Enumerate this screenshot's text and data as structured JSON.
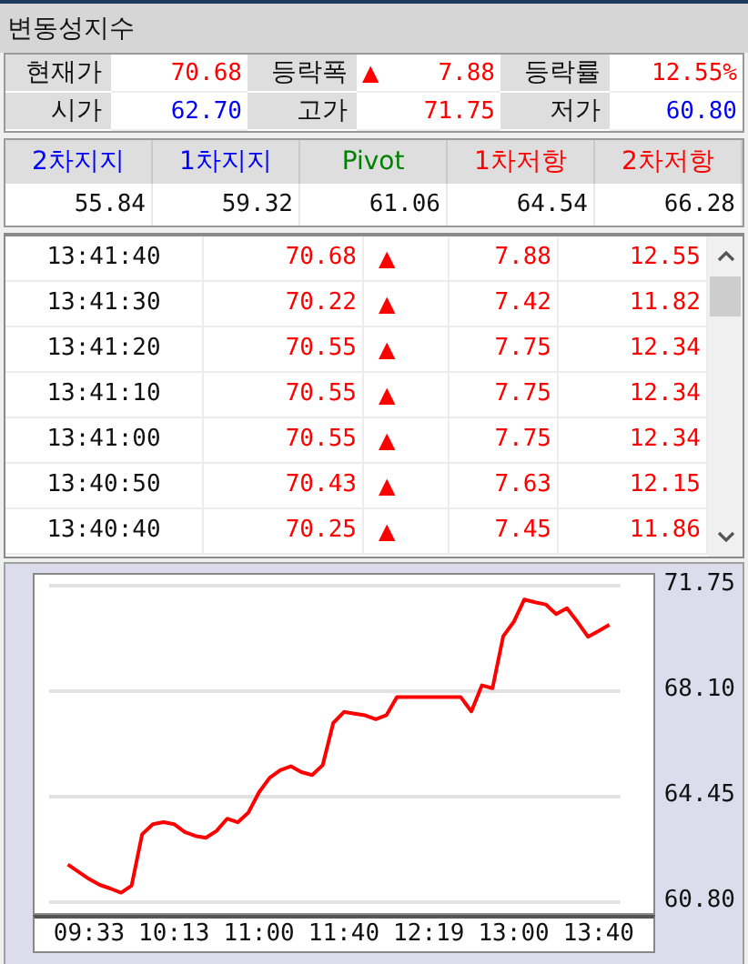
{
  "title": "변동성지수",
  "quote": [
    {
      "label": "현재가",
      "value": "70.68",
      "color": "#ff0000"
    },
    {
      "label": "등락폭",
      "value": "7.88",
      "color": "#ff0000",
      "arrow": "▲"
    },
    {
      "label": "등락률",
      "value": "12.55%",
      "color": "#ff0000"
    },
    {
      "label": "시가",
      "value": "62.70",
      "color": "#0000ff"
    },
    {
      "label": "고가",
      "value": "71.75",
      "color": "#ff0000"
    },
    {
      "label": "저가",
      "value": "60.80",
      "color": "#0000ff"
    }
  ],
  "pivots": [
    {
      "label": "2차지지",
      "value": "55.84",
      "color": "#0000ff"
    },
    {
      "label": "1차지지",
      "value": "59.32",
      "color": "#0000ff"
    },
    {
      "label": "Pivot",
      "value": "61.06",
      "color": "#008000"
    },
    {
      "label": "1차저항",
      "value": "64.54",
      "color": "#ff0000"
    },
    {
      "label": "2차저항",
      "value": "66.28",
      "color": "#ff0000"
    }
  ],
  "ticks": [
    {
      "time": "13:41:40",
      "price": "70.68",
      "arrow": "▲",
      "change": "7.88",
      "rate": "12.55"
    },
    {
      "time": "13:41:30",
      "price": "70.22",
      "arrow": "▲",
      "change": "7.42",
      "rate": "11.82"
    },
    {
      "time": "13:41:20",
      "price": "70.55",
      "arrow": "▲",
      "change": "7.75",
      "rate": "12.34"
    },
    {
      "time": "13:41:10",
      "price": "70.55",
      "arrow": "▲",
      "change": "7.75",
      "rate": "12.34"
    },
    {
      "time": "13:41:00",
      "price": "70.55",
      "arrow": "▲",
      "change": "7.75",
      "rate": "12.34"
    },
    {
      "time": "13:40:50",
      "price": "70.43",
      "arrow": "▲",
      "change": "7.63",
      "rate": "12.15"
    },
    {
      "time": "13:40:40",
      "price": "70.25",
      "arrow": "▲",
      "change": "7.45",
      "rate": "11.86"
    }
  ],
  "chart": {
    "chart_data": {
      "type": "line",
      "categories": [
        null,
        null,
        "09:33",
        null,
        null,
        null,
        null,
        null,
        null,
        null,
        "10:13",
        null,
        null,
        null,
        null,
        null,
        null,
        null,
        "11:00",
        null,
        null,
        null,
        null,
        null,
        null,
        null,
        "11:40",
        null,
        null,
        null,
        null,
        null,
        null,
        null,
        "12:19",
        null,
        null,
        null,
        null,
        null,
        null,
        null,
        "13:00",
        null,
        null,
        null,
        null,
        null,
        null,
        null,
        "13:40",
        null
      ],
      "values": [
        62.1,
        61.85,
        61.6,
        61.4,
        61.27,
        61.13,
        61.37,
        63.15,
        63.5,
        63.57,
        63.5,
        63.23,
        63.09,
        63.03,
        63.27,
        63.69,
        63.56,
        63.9,
        64.6,
        65.1,
        65.37,
        65.5,
        65.3,
        65.2,
        65.54,
        67.0,
        67.38,
        67.32,
        67.26,
        67.13,
        67.27,
        67.9,
        67.9,
        67.9,
        67.9,
        67.9,
        67.9,
        67.9,
        67.4,
        68.3,
        68.2,
        70.0,
        70.5,
        71.27,
        71.18,
        71.1,
        70.77,
        70.97,
        70.5,
        69.98,
        70.18,
        70.4
      ],
      "color": "#ff0000",
      "ylim": [
        60.8,
        71.75
      ],
      "yticks": [
        {
          "value": 60.8,
          "label": "60.80"
        },
        64.45,
        {
          "value": 68.1,
          "label": "68.10"
        },
        71.75
      ]
    }
  }
}
